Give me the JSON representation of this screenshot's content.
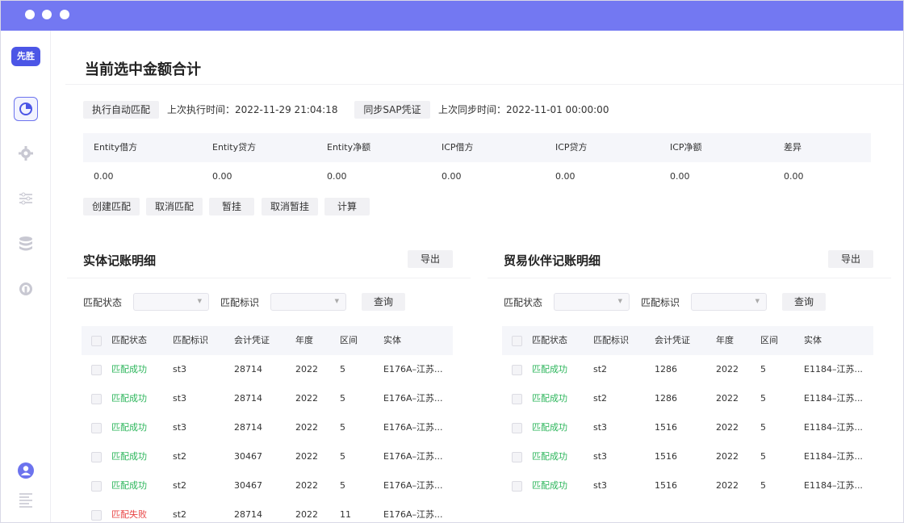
{
  "window": {
    "title_bar_color": "#7378f2"
  },
  "sidebar": {
    "logo": "先胜",
    "icons": [
      "dashboard-icon",
      "gear-icon",
      "sliders-icon",
      "database-icon",
      "headset-icon",
      "user-avatar-icon",
      "menu-lines-icon"
    ]
  },
  "page": {
    "title": "当前选中金额合计",
    "auto_match_button": "执行自动匹配",
    "last_run_label": "上次执行时间：2022-11-29 21:04:18",
    "sync_button": "同步SAP凭证",
    "last_sync_label": "上次同步时间：2022-11-01 00:00:00"
  },
  "summary": {
    "headers": [
      "Entity借方",
      "Entity贷方",
      "Entity净额",
      "ICP借方",
      "ICP贷方",
      "ICP净额",
      "差异"
    ],
    "values": [
      "0.00",
      "0.00",
      "0.00",
      "0.00",
      "0.00",
      "0.00",
      "0.00"
    ]
  },
  "actions": {
    "create_match": "创建匹配",
    "cancel_match": "取消匹配",
    "hold": "暂挂",
    "cancel_hold": "取消暂挂",
    "calculate": "计算"
  },
  "left_panel": {
    "title": "实体记账明细",
    "export": "导出",
    "filter_status_label": "匹配状态",
    "filter_flag_label": "匹配标识",
    "query": "查询",
    "columns": [
      "匹配状态",
      "匹配标识",
      "会计凭证",
      "年度",
      "区间",
      "实体"
    ],
    "rows": [
      {
        "status": "匹配成功",
        "flag": "st3",
        "voucher": "28714",
        "year": "2022",
        "period": "5",
        "entity": "E176A–江苏..."
      },
      {
        "status": "匹配成功",
        "flag": "st3",
        "voucher": "28714",
        "year": "2022",
        "period": "5",
        "entity": "E176A–江苏..."
      },
      {
        "status": "匹配成功",
        "flag": "st3",
        "voucher": "28714",
        "year": "2022",
        "period": "5",
        "entity": "E176A–江苏..."
      },
      {
        "status": "匹配成功",
        "flag": "st2",
        "voucher": "30467",
        "year": "2022",
        "period": "5",
        "entity": "E176A–江苏..."
      },
      {
        "status": "匹配成功",
        "flag": "st2",
        "voucher": "30467",
        "year": "2022",
        "period": "5",
        "entity": "E176A–江苏..."
      },
      {
        "status": "匹配失败",
        "flag": "st2",
        "voucher": "28714",
        "year": "2022",
        "period": "11",
        "entity": "E176A–江苏..."
      }
    ]
  },
  "right_panel": {
    "title": "贸易伙伴记账明细",
    "export": "导出",
    "filter_status_label": "匹配状态",
    "filter_flag_label": "匹配标识",
    "query": "查询",
    "columns": [
      "匹配状态",
      "匹配标识",
      "会计凭证",
      "年度",
      "区间",
      "实体"
    ],
    "rows": [
      {
        "status": "匹配成功",
        "flag": "st2",
        "voucher": "1286",
        "year": "2022",
        "period": "5",
        "entity": "E1184–江苏..."
      },
      {
        "status": "匹配成功",
        "flag": "st2",
        "voucher": "1286",
        "year": "2022",
        "period": "5",
        "entity": "E1184–江苏..."
      },
      {
        "status": "匹配成功",
        "flag": "st3",
        "voucher": "1516",
        "year": "2022",
        "period": "5",
        "entity": "E1184–江苏..."
      },
      {
        "status": "匹配成功",
        "flag": "st3",
        "voucher": "1516",
        "year": "2022",
        "period": "5",
        "entity": "E1184–江苏..."
      },
      {
        "status": "匹配成功",
        "flag": "st3",
        "voucher": "1516",
        "year": "2022",
        "period": "5",
        "entity": "E1184–江苏..."
      }
    ]
  },
  "colors": {
    "success": "#2bb55a",
    "fail": "#e84545",
    "accent": "#4c56e6"
  }
}
